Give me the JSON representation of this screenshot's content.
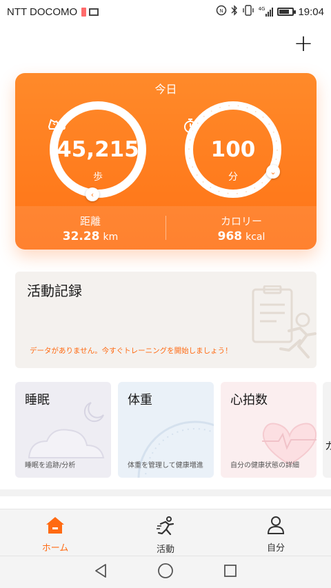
{
  "status_bar": {
    "carrier": "NTT DOCOMO",
    "network": "4G",
    "time": "19:04",
    "battery_level": 0.75
  },
  "header": {
    "add_label": "+"
  },
  "today_card": {
    "title": "今日",
    "steps": {
      "value": "45,215",
      "unit": "歩",
      "icon": "shoe-icon"
    },
    "minutes": {
      "value": "100",
      "unit": "分",
      "icon": "stopwatch-icon"
    },
    "distance": {
      "label": "距離",
      "value": "32.28",
      "unit": "km"
    },
    "calories": {
      "label": "カロリー",
      "value": "968",
      "unit": "kcal"
    }
  },
  "activity": {
    "title": "活動記録",
    "empty_message": "データがありません。今すぐトレーニングを開始しましょう！"
  },
  "cards": {
    "sleep": {
      "title": "睡眠",
      "desc": "睡眠を追跡/分析"
    },
    "weight": {
      "title": "体重",
      "desc": "体重を管理して健康増進"
    },
    "heart": {
      "title": "心拍数",
      "desc": "自分の健康状態の詳細"
    },
    "peek": {
      "title": "カ"
    }
  },
  "nav": {
    "home": "ホーム",
    "activity": "活動",
    "me": "自分"
  },
  "colors": {
    "accent": "#ff7a1c",
    "accent_text": "#ff6a12"
  }
}
